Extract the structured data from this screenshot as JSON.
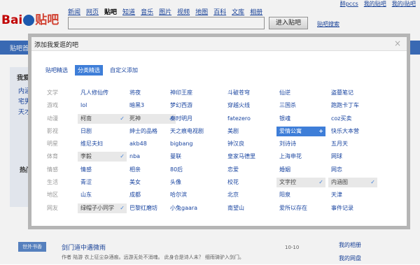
{
  "page": {
    "logo_text": "Bai",
    "logo_paw": "du",
    "logo_tieba": "贴吧",
    "nav": [
      "新闻",
      "网页",
      "贴吧",
      "知道",
      "音乐",
      "图片",
      "视频",
      "地图",
      "百科",
      "文库",
      "相册"
    ],
    "nav_current_index": 2,
    "top_right": [
      "醉pccs",
      "我的贴吧",
      "我的i贴吧"
    ],
    "search_button": "进入贴吧",
    "tieba_search": "贴吧搜索",
    "bluebar_text": "贴吧首",
    "side_title": "我爱",
    "side_links": [
      "内涵",
      "宅男",
      "天才"
    ],
    "hot_title": "热门",
    "bottom_badge": "世外书香",
    "bottom_title": "剑门道中遇微雨",
    "bottom_sub": "作者 陆游  衣上征尘杂酒痕。远游无处不消魂。 此身合是诗人未？ 细雨骑驴入剑门。",
    "bottom_num": "10-10",
    "right_links": [
      "我的相册",
      "我的网盘"
    ]
  },
  "modal": {
    "title": "添加我爱逛的吧",
    "close": "×",
    "tabs": [
      "贴吧精选",
      "分类精选",
      "自定义添加"
    ],
    "active_tab": 1,
    "rows": [
      {
        "cat": "文学",
        "items": [
          "凡人修仙传",
          "将夜",
          "神印王座",
          "斗破苍穹",
          "仙逆",
          "盗墓笔记"
        ]
      },
      {
        "cat": "游戏",
        "items": [
          "lol",
          "暗黑3",
          "梦幻西游",
          "穿越火线",
          "三国杀",
          "跑跑卡丁车"
        ]
      },
      {
        "cat": "动漫",
        "items": [
          "柯南",
          "死神",
          "秦时明月",
          "fatezero",
          "银魂",
          "coz买卖"
        ]
      },
      {
        "cat": "影视",
        "items": [
          "日剧",
          "绅士的品格",
          "天之痕电视剧",
          "美剧",
          "爱情公寓",
          "快乐大本营"
        ]
      },
      {
        "cat": "明星",
        "items": [
          "维尼夫妇",
          "akb48",
          "bigbang",
          "钟汉良",
          "刘诗诗",
          "五月天"
        ]
      },
      {
        "cat": "体育",
        "items": [
          "李毅",
          "nba",
          "曼联",
          "皇家马德里",
          "上海申花",
          "网球"
        ]
      },
      {
        "cat": "情感",
        "items": [
          "情感",
          "相亲",
          "80后",
          "恋爱",
          "婚姻",
          "网恋"
        ]
      },
      {
        "cat": "生活",
        "items": [
          "青涩",
          "美女",
          "头像",
          "校花",
          "文字控",
          "内涵图"
        ]
      },
      {
        "cat": "地区",
        "items": [
          "山东",
          "成都",
          "哈尔滨",
          "北京",
          "阳泉",
          "天津"
        ]
      },
      {
        "cat": "网友",
        "items": [
          "绿帽子小同学",
          "巴黎红磨坊",
          "小兔gaara",
          "南望山",
          "爱所以存在",
          "事件记录"
        ]
      }
    ],
    "selected": {
      "2-0": "check",
      "2-1": "check",
      "3-4": "plus",
      "5-0": "check",
      "7-4": "check",
      "7-5": "check",
      "9-0": "check"
    },
    "check_glyph": "✓",
    "plus_glyph": "+"
  }
}
